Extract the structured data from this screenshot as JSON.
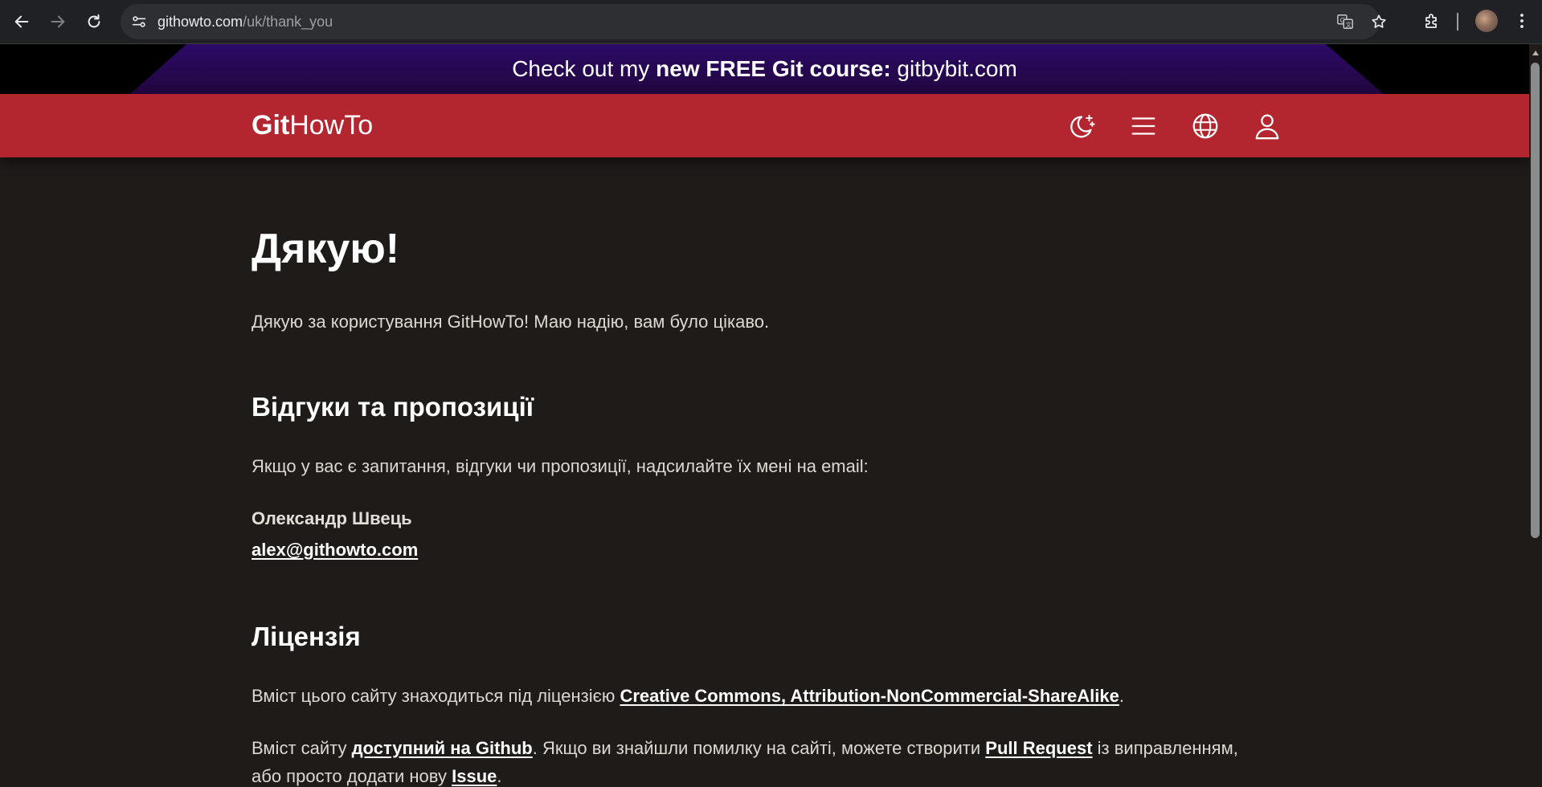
{
  "browser": {
    "url_host": "githowto.com",
    "url_path": "/uk/thank_you"
  },
  "promo": {
    "prefix": "Check out my ",
    "bold": "new FREE Git course:",
    "suffix": " gitbybit.com"
  },
  "header": {
    "logo_bold": "Git",
    "logo_rest": "HowTo",
    "icons": [
      "theme-moon-icon",
      "menu-icon",
      "language-globe-icon",
      "user-icon"
    ]
  },
  "page": {
    "title": "Дякую!",
    "intro": "Дякую за користування GitHowTo! Маю надію, вам було цікаво.",
    "feedback": {
      "heading": "Відгуки та пропозиції",
      "text": "Якщо у вас є запитання, відгуки чи пропозиції, надсилайте їх мені на email:",
      "name": "Олександр Швець",
      "email": "alex@githowto.com"
    },
    "license": {
      "heading": "Ліцензія",
      "text_prefix": "Вміст цього сайту знаходиться під ліцензією ",
      "license_link": "Creative Commons, Attribution-NonCommercial-ShareAlike",
      "text_suffix": ".",
      "github_prefix": "Вміст сайту ",
      "github_link": "доступний на Github",
      "github_middle": ". Якщо ви знайшли помилку на сайті, можете створити ",
      "pr_link": "Pull Request",
      "github_suffix": " із виправленням,",
      "line2_prefix": "або просто додати нову ",
      "issue_link": "Issue",
      "line2_suffix": "."
    }
  },
  "colors": {
    "header_red": "#b3262f",
    "page_bg": "#1e1b19",
    "promo_purple": "#2a0a5e"
  }
}
